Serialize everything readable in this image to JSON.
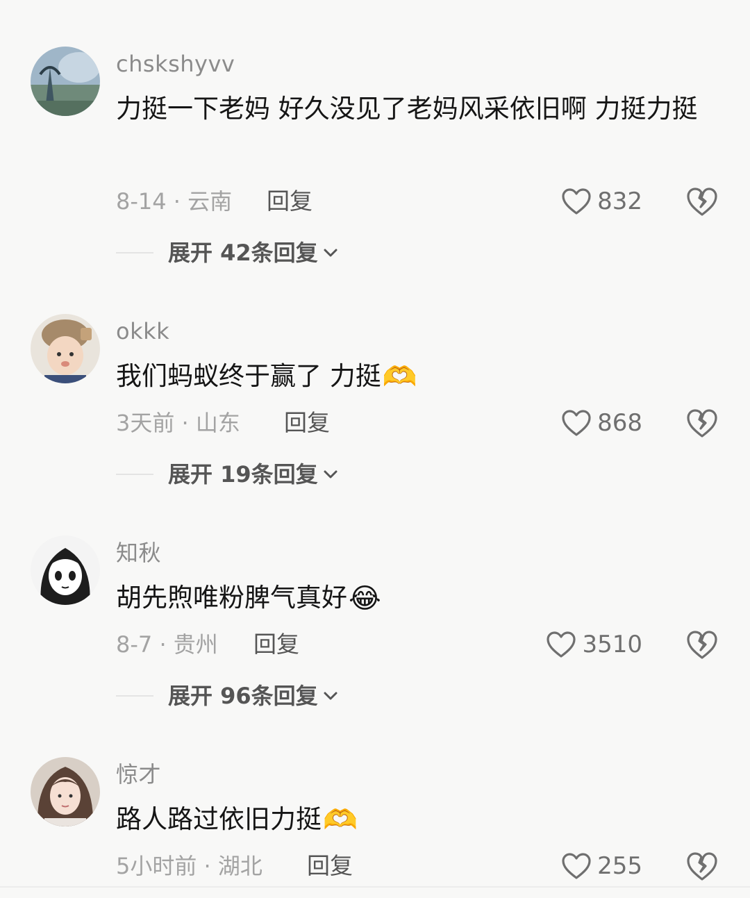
{
  "comments": [
    {
      "username": "chskshyvv",
      "text": "力挺一下老妈 好久没见了老妈风采依旧啊 力挺力挺",
      "emoji": "",
      "date_location": "8-14 · 云南",
      "reply_label": "回复",
      "likes": "832",
      "expand_label": "展开 42条回复",
      "avatar_icon": "landscape-avatar"
    },
    {
      "username": "okkk",
      "text": "我们蚂蚁终于赢了 力挺",
      "emoji": "🫶",
      "date_location": "3天前 · 山东",
      "reply_label": "回复",
      "likes": "868",
      "expand_label": "展开 19条回复",
      "avatar_icon": "baby-avatar"
    },
    {
      "username": "知秋",
      "text": "胡先煦唯粉脾气真好",
      "emoji": "😂",
      "date_location": "8-7 · 贵州",
      "reply_label": "回复",
      "likes": "3510",
      "expand_label": "展开 96条回复",
      "avatar_icon": "anime-girl-avatar"
    },
    {
      "username": "惊才",
      "text": "路人路过依旧力挺",
      "emoji": "🫶",
      "date_location": "5小时前 · 湖北",
      "reply_label": "回复",
      "likes": "255",
      "avatar_icon": "girl-photo-avatar"
    }
  ],
  "colors": {
    "background": "#f8f8f7",
    "username": "#8b8b8b",
    "text": "#151515",
    "meta": "#a3a3a3"
  }
}
